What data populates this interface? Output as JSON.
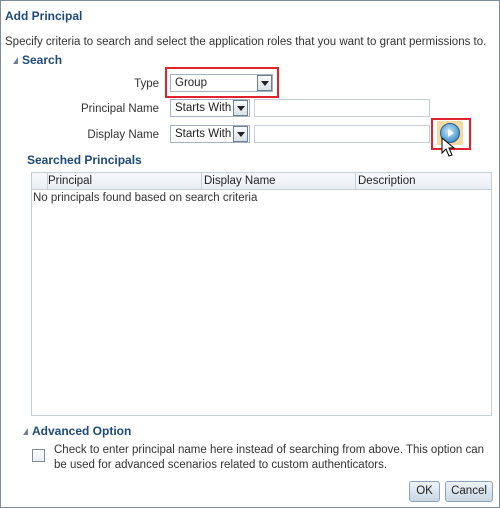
{
  "dialog": {
    "title": "Add Principal",
    "instructions": "Specify criteria to search and select the application roles that you want to grant permissions to."
  },
  "search": {
    "section_title": "Search",
    "type_label": "Type",
    "type_value": "Group",
    "principal_name_label": "Principal Name",
    "principal_name_operator": "Starts With",
    "principal_name_value": "",
    "display_name_label": "Display Name",
    "display_name_operator": "Starts With",
    "display_name_value": ""
  },
  "results": {
    "section_title": "Searched Principals",
    "columns": [
      "Principal",
      "Display Name",
      "Description"
    ],
    "empty_message": "No principals found based on search criteria"
  },
  "advanced": {
    "section_title": "Advanced Option",
    "checkbox_text": "Check to enter principal name here instead of searching from above. This option can be used for advanced scenarios related to custom authenticators.",
    "checked": false
  },
  "buttons": {
    "ok": "OK",
    "cancel": "Cancel"
  },
  "colors": {
    "highlight": "#e0232c",
    "heading": "#1d4a7a"
  }
}
